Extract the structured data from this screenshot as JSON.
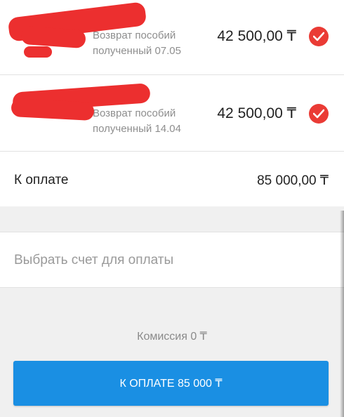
{
  "payments": [
    {
      "description": "Возврат пособий\nполученный 07.05",
      "amount": "42 500,00 ₸",
      "checked": true
    },
    {
      "description": "Возврат пособий\nполученный 14.04",
      "amount": "42 500,00 ₸",
      "checked": true
    }
  ],
  "total": {
    "label": "К оплате",
    "value": "85 000,00 ₸"
  },
  "select_account": {
    "label": "Выбрать счет для оплаты"
  },
  "commission": "Комиссия 0 ₸",
  "pay_button": {
    "label": "К ОПЛАТЕ 85 000 ₸"
  },
  "colors": {
    "accent": "#1a8fe3",
    "check": "#ea3b35",
    "redaction": "#ec2f2f"
  }
}
